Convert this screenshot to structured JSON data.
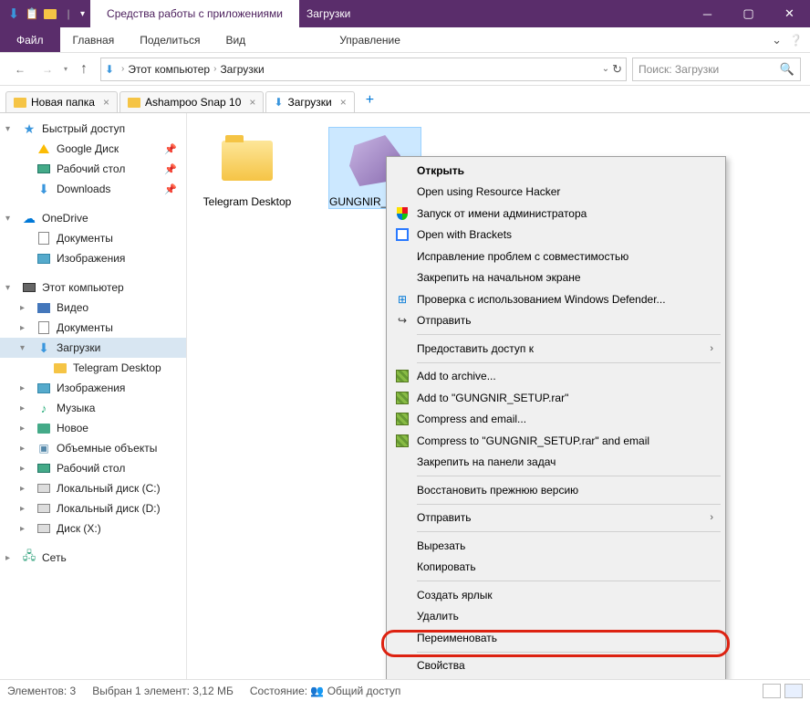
{
  "titlebar": {
    "tool_label": "Средства работы с приложениями",
    "title": "Загрузки"
  },
  "menu": {
    "file": "Файл",
    "home": "Главная",
    "share": "Поделиться",
    "view": "Вид",
    "manage": "Управление"
  },
  "breadcrumb": {
    "pc": "Этот компьютер",
    "loc": "Загрузки"
  },
  "search": {
    "placeholder": "Поиск: Загрузки"
  },
  "tabs": [
    {
      "label": "Новая папка"
    },
    {
      "label": "Ashampoo Snap 10"
    },
    {
      "label": "Загрузки"
    }
  ],
  "sidebar": {
    "quick": "Быстрый доступ",
    "gdrive": "Google Диск",
    "desktop": "Рабочий стол",
    "downloads_en": "Downloads",
    "onedrive": "OneDrive",
    "docs": "Документы",
    "images": "Изображения",
    "thispc": "Этот компьютер",
    "video": "Видео",
    "docs2": "Документы",
    "downloads_ru": "Загрузки",
    "telegram": "Telegram Desktop",
    "images2": "Изображения",
    "music": "Музыка",
    "new": "Новое",
    "objects": "Объемные объекты",
    "desktop2": "Рабочий стол",
    "diskC": "Локальный диск (C:)",
    "diskD": "Локальный диск (D:)",
    "diskX": "Диск (X:)",
    "network": "Сеть"
  },
  "files": {
    "folder_name": "Telegram Desktop",
    "exe_name": "GUNGNIR_SETUP.exe"
  },
  "context_menu": {
    "open": "Открыть",
    "resource_hacker": "Open using Resource Hacker",
    "run_admin": "Запуск от имени администратора",
    "brackets": "Open with Brackets",
    "compat": "Исправление проблем с совместимостью",
    "pin_start": "Закрепить на начальном экране",
    "defender": "Проверка с использованием Windows Defender...",
    "send1": "Отправить",
    "share_access": "Предоставить доступ к",
    "add_archive": "Add to archive...",
    "add_rar": "Add to \"GUNGNIR_SETUP.rar\"",
    "compress_email": "Compress and email...",
    "compress_rar_email": "Compress to \"GUNGNIR_SETUP.rar\" and email",
    "pin_taskbar": "Закрепить на панели задач",
    "restore": "Восстановить прежнюю версию",
    "send2": "Отправить",
    "cut": "Вырезать",
    "copy": "Копировать",
    "shortcut": "Создать ярлык",
    "delete": "Удалить",
    "rename": "Переименовать",
    "properties": "Свойства"
  },
  "status": {
    "count": "Элементов: 3",
    "selected": "Выбран 1 элемент: 3,12 МБ",
    "state_label": "Состояние:",
    "state_value": "Общий доступ"
  }
}
